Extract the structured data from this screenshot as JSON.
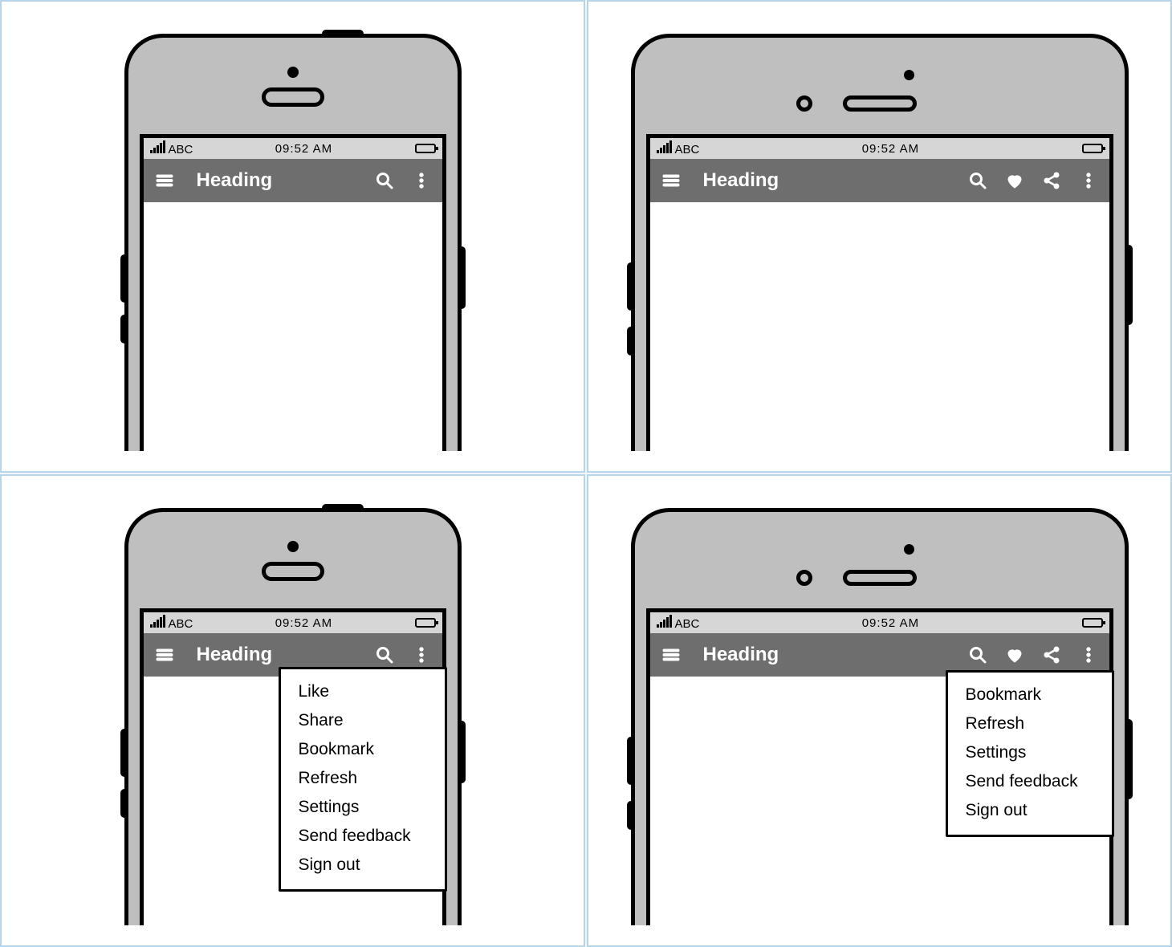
{
  "statusbar": {
    "carrier": "ABC",
    "time": "09:52 AM"
  },
  "appbar": {
    "title": "Heading"
  },
  "menus": {
    "narrow": [
      "Like",
      "Share",
      "Bookmark",
      "Refresh",
      "Settings",
      "Send feedback",
      "Sign out"
    ],
    "wide": [
      "Bookmark",
      "Refresh",
      "Settings",
      "Send feedback",
      "Sign out"
    ]
  },
  "icons": {
    "menu": "hamburger-icon",
    "search": "search-icon",
    "heart": "heart-icon",
    "share": "share-icon",
    "overflow": "overflow-icon"
  }
}
